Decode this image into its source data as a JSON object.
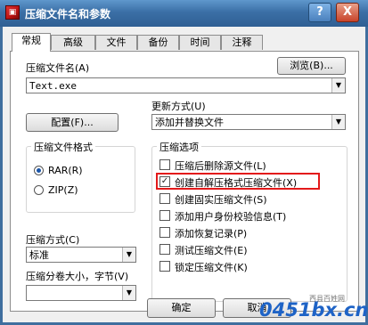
{
  "window": {
    "title": "压缩文件名和参数",
    "help_symbol": "?",
    "close_symbol": "X"
  },
  "tabs": [
    {
      "label": "常规",
      "active": true
    },
    {
      "label": "高级"
    },
    {
      "label": "文件"
    },
    {
      "label": "备份"
    },
    {
      "label": "时间"
    },
    {
      "label": "注释"
    }
  ],
  "archive_name": {
    "label": "压缩文件名(A)",
    "value": "Text.exe",
    "browse_label": "浏览(B)..."
  },
  "update_mode": {
    "label": "更新方式(U)",
    "value": "添加并替换文件"
  },
  "profiles_label": "配置(F)...",
  "archive_format": {
    "title": "压缩文件格式",
    "options": [
      {
        "label": "RAR(R)",
        "selected": true
      },
      {
        "label": "ZIP(Z)",
        "selected": false
      }
    ]
  },
  "compression_method": {
    "label": "压缩方式(C)",
    "value": "标准"
  },
  "split_volumes": {
    "label": "压缩分卷大小，字节(V)",
    "value": ""
  },
  "archive_options": {
    "title": "压缩选项",
    "items": [
      {
        "label": "压缩后删除源文件(L)",
        "checked": false
      },
      {
        "label": "创建自解压格式压缩文件(X)",
        "checked": true,
        "highlighted": true
      },
      {
        "label": "创建固实压缩文件(S)",
        "checked": false
      },
      {
        "label": "添加用户身份校验信息(T)",
        "checked": false
      },
      {
        "label": "添加恢复记录(P)",
        "checked": false
      },
      {
        "label": "测试压缩文件(E)",
        "checked": false
      },
      {
        "label": "锁定压缩文件(K)",
        "checked": false
      }
    ]
  },
  "buttons": {
    "ok": "确定",
    "cancel": "取消"
  },
  "watermark": {
    "line1": "西县百姓网",
    "main": "0451bx.cn"
  },
  "colors": {
    "highlight": "#e3191a",
    "watermark_blue": "#1e63c6"
  }
}
